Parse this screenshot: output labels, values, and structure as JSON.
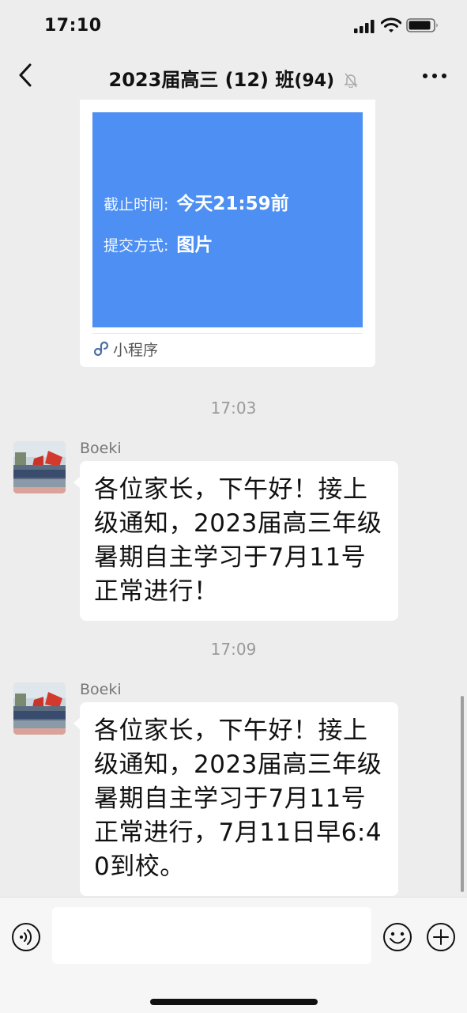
{
  "status_bar": {
    "time": "17:10"
  },
  "header": {
    "title": "2023届高三 (12) 班",
    "member_count": "(94)"
  },
  "mini_program": {
    "fields": [
      {
        "label": "截止时间:",
        "value": "今天21:59前"
      },
      {
        "label": "提交方式:",
        "value": "图片"
      }
    ],
    "footer_label": "小程序"
  },
  "messages": [
    {
      "timestamp": "17:03",
      "sender": "Boeki",
      "text": "各位家长，下午好！接上级通知，2023届高三年级暑期自主学习于7月11号正常进行！"
    },
    {
      "timestamp": "17:09",
      "sender": "Boeki",
      "text": "各位家长，下午好！接上级通知，2023届高三年级暑期自主学习于7月11号正常进行，7月11日早6:40到校。"
    }
  ],
  "input": {
    "placeholder": ""
  },
  "colors": {
    "background": "#ededed",
    "mini_program_blue": "#4d8ff2",
    "bubble": "#ffffff"
  },
  "icons": [
    "back-chevron-icon",
    "mute-bell-icon",
    "more-dots-icon",
    "link-icon",
    "voice-icon",
    "emoji-icon",
    "plus-icon",
    "signal-icon",
    "wifi-icon",
    "battery-icon"
  ]
}
